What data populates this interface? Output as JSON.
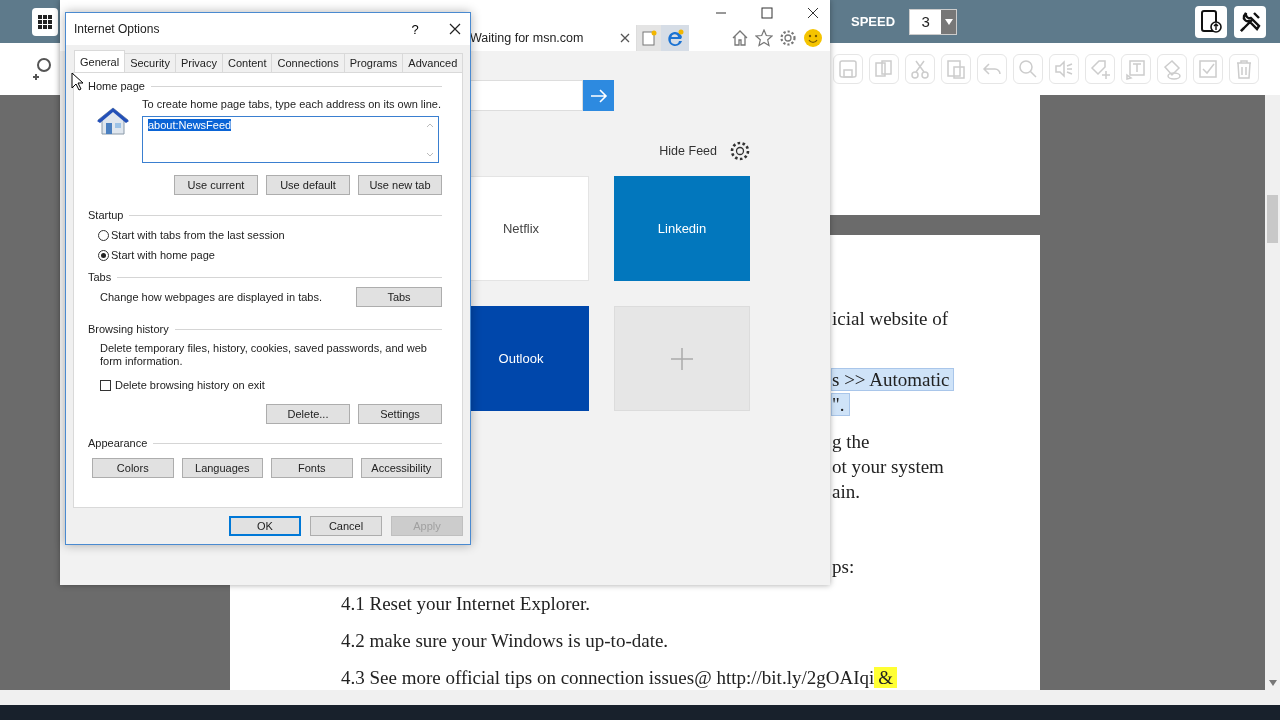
{
  "app": {
    "speed_label": "SPEED",
    "speed_value": "3"
  },
  "document": {
    "blocks": [
      {
        "kind": "fragment",
        "lines": [
          [
            {
              "text": "icial website of",
              "selected": false,
              "marked": false
            }
          ]
        ]
      },
      {
        "kind": "fragment",
        "lines": [
          [
            {
              "text": "s >> Automatic",
              "selected": true,
              "marked": false
            }
          ],
          [
            {
              "text": "\".",
              "selected": true,
              "marked": false
            }
          ]
        ]
      },
      {
        "kind": "fragment",
        "lines": [
          [
            {
              "text": "g the",
              "selected": false,
              "marked": false
            }
          ],
          [
            {
              "text": "ot your system",
              "selected": false,
              "marked": false
            }
          ],
          [
            {
              "text": "ain.",
              "selected": false,
              "marked": false
            }
          ]
        ]
      },
      {
        "kind": "fragment",
        "lines": [
          [
            {
              "text": "ps:",
              "selected": false,
              "marked": false
            }
          ]
        ]
      },
      {
        "kind": "item",
        "lines": [
          [
            {
              "text": "4.1 Reset your Internet Explorer.",
              "selected": false,
              "marked": false
            }
          ]
        ]
      },
      {
        "kind": "item",
        "lines": [
          [
            {
              "text": "4.2 make sure your Windows is up-to-date.",
              "selected": false,
              "marked": false
            }
          ]
        ]
      },
      {
        "kind": "item",
        "lines": [
          [
            {
              "text": "4.3 See more official tips on connection issues@ http://bit.ly/2gOAIqi",
              "selected": false,
              "marked": false
            },
            {
              "text": "&",
              "selected": false,
              "marked": true
            }
          ]
        ]
      }
    ]
  },
  "browser": {
    "tab_title": "Waiting for msn.com",
    "hide_feed": "Hide Feed",
    "tiles": [
      {
        "kind": "light",
        "label": "Netflix",
        "color": "#ffffff"
      },
      {
        "kind": "dark",
        "label": "Linkedin",
        "color": "#0277bd"
      },
      {
        "kind": "dark",
        "label": "Outlook",
        "color": "#0047ab"
      },
      {
        "kind": "add",
        "color": "#e6e6e6"
      }
    ]
  },
  "dialog": {
    "title": "Internet Options",
    "help": "?",
    "tabs": [
      {
        "label": "General",
        "selected": true
      },
      {
        "label": "Security",
        "selected": false
      },
      {
        "label": "Privacy",
        "selected": false
      },
      {
        "label": "Content",
        "selected": false
      },
      {
        "label": "Connections",
        "selected": false
      },
      {
        "label": "Programs",
        "selected": false
      },
      {
        "label": "Advanced",
        "selected": false
      }
    ],
    "home_page": {
      "legend": "Home page",
      "hint": "To create home page tabs, type each address on its own line.",
      "value": "about:NewsFeed",
      "value_selected": true,
      "buttons": [
        "Use current",
        "Use default",
        "Use new tab"
      ]
    },
    "startup": {
      "legend": "Startup",
      "options": [
        {
          "label": "Start with tabs from the last session",
          "selected": false
        },
        {
          "label": "Start with home page",
          "selected": true
        }
      ]
    },
    "tabs_section": {
      "legend": "Tabs",
      "text": "Change how webpages are displayed in tabs.",
      "button": "Tabs"
    },
    "browsing_history": {
      "legend": "Browsing history",
      "text": "Delete temporary files, history, cookies, saved passwords, and web form information.",
      "checkbox": {
        "label": "Delete browsing history on exit",
        "checked": false
      },
      "buttons": [
        "Delete...",
        "Settings"
      ]
    },
    "appearance": {
      "legend": "Appearance",
      "buttons": [
        "Colors",
        "Languages",
        "Fonts",
        "Accessibility"
      ]
    },
    "footer": [
      {
        "label": "OK",
        "kind": "default"
      },
      {
        "label": "Cancel",
        "kind": "normal"
      },
      {
        "label": "Apply",
        "kind": "disabled"
      }
    ]
  }
}
